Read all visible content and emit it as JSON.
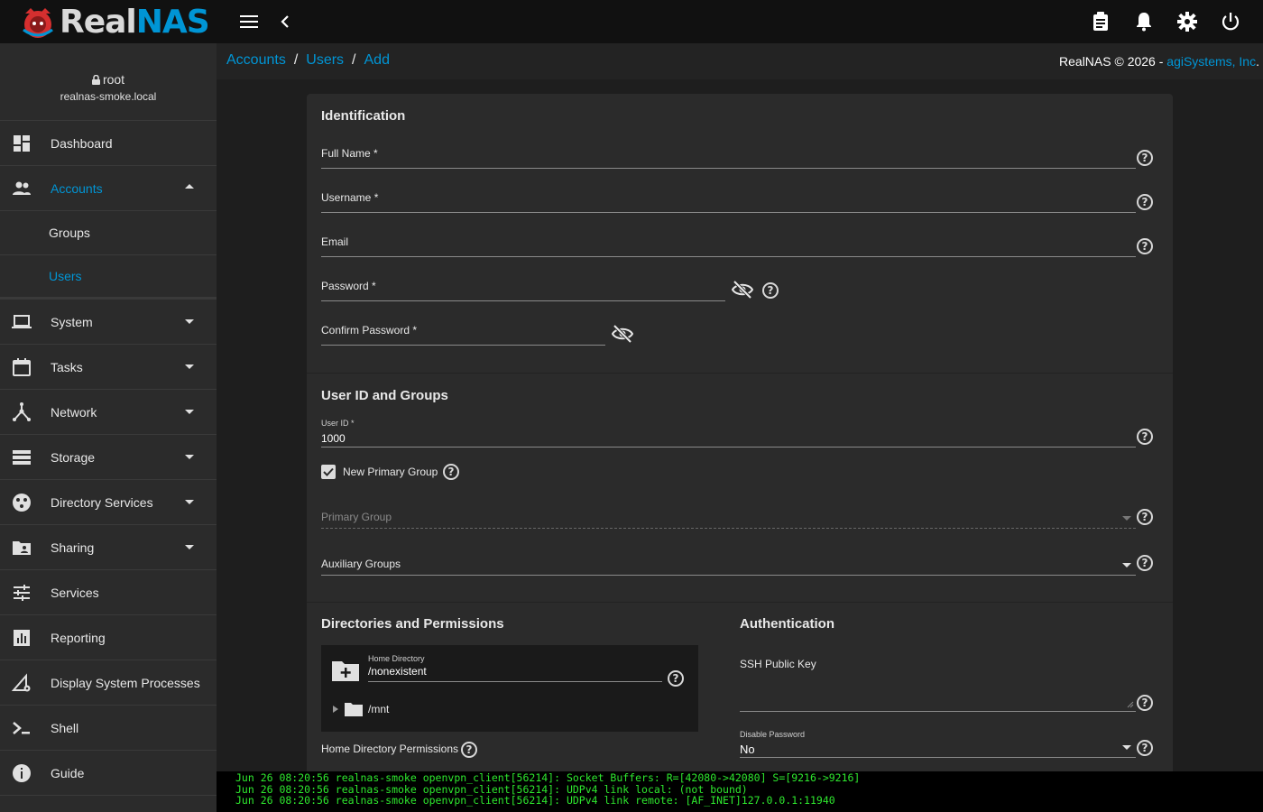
{
  "app": {
    "logo_part1": "Real",
    "logo_part2": "NAS"
  },
  "colors": {
    "accent": "#0095d5",
    "terminal_text": "#2ee82e",
    "sidebar_bg": "#2b2b2b",
    "topbar_bg": "#111111"
  },
  "topbar": {
    "icons": [
      "menu-icon",
      "back-chevron-icon",
      "clipboard-icon",
      "bell-icon",
      "gear-icon",
      "power-icon"
    ]
  },
  "user": {
    "name": "root",
    "host": "realnas-smoke.local"
  },
  "sidebar": {
    "items": [
      {
        "label": "Dashboard",
        "icon": "dashboard-icon"
      },
      {
        "label": "Accounts",
        "icon": "people-icon"
      },
      {
        "label": "System",
        "icon": "laptop-icon"
      },
      {
        "label": "Tasks",
        "icon": "calendar-icon"
      },
      {
        "label": "Network",
        "icon": "network-icon"
      },
      {
        "label": "Storage",
        "icon": "storage-icon"
      },
      {
        "label": "Directory Services",
        "icon": "directory-icon"
      },
      {
        "label": "Sharing",
        "icon": "folder-shared-icon"
      },
      {
        "label": "Services",
        "icon": "tune-icon"
      },
      {
        "label": "Reporting",
        "icon": "chart-icon"
      },
      {
        "label": "Display System Processes",
        "icon": "processes-icon"
      },
      {
        "label": "Shell",
        "icon": "shell-icon"
      },
      {
        "label": "Guide",
        "icon": "info-icon"
      }
    ],
    "subitems": [
      {
        "label": "Groups"
      },
      {
        "label": "Users"
      }
    ]
  },
  "breadcrumb": {
    "items": [
      "Accounts",
      "Users",
      "Add"
    ],
    "sep": "/"
  },
  "copyright": {
    "text": "RealNAS © 2026 - ",
    "company": "agiSystems, Inc",
    "suffix": "."
  },
  "form": {
    "identification": {
      "title": "Identification",
      "full_name": "Full Name *",
      "username": "Username *",
      "email": "Email",
      "password": "Password *",
      "confirm_password": "Confirm Password *"
    },
    "user_id_groups": {
      "title": "User ID and Groups",
      "user_id_label": "User ID *",
      "user_id_value": "1000",
      "new_primary_group": "New Primary Group",
      "new_primary_group_checked": true,
      "primary_group": "Primary Group",
      "auxiliary_groups": "Auxiliary Groups"
    },
    "directories": {
      "title": "Directories and Permissions",
      "home_dir_label": "Home Directory",
      "home_dir_value": "/nonexistent",
      "tree_root": "/mnt",
      "home_dir_permissions": "Home Directory Permissions"
    },
    "authentication": {
      "title": "Authentication",
      "ssh_key": "SSH Public Key",
      "disable_password_label": "Disable Password",
      "disable_password_value": "No"
    }
  },
  "help_glyph": "?",
  "terminal": {
    "lines": [
      "Jun 26 08:20:56 realnas-smoke openvpn_client[56214]: Socket Buffers: R=[42080->42080] S=[9216->9216]",
      "Jun 26 08:20:56 realnas-smoke openvpn_client[56214]: UDPv4 link local: (not bound)",
      "Jun 26 08:20:56 realnas-smoke openvpn_client[56214]: UDPv4 link remote: [AF_INET]127.0.0.1:11940"
    ]
  }
}
